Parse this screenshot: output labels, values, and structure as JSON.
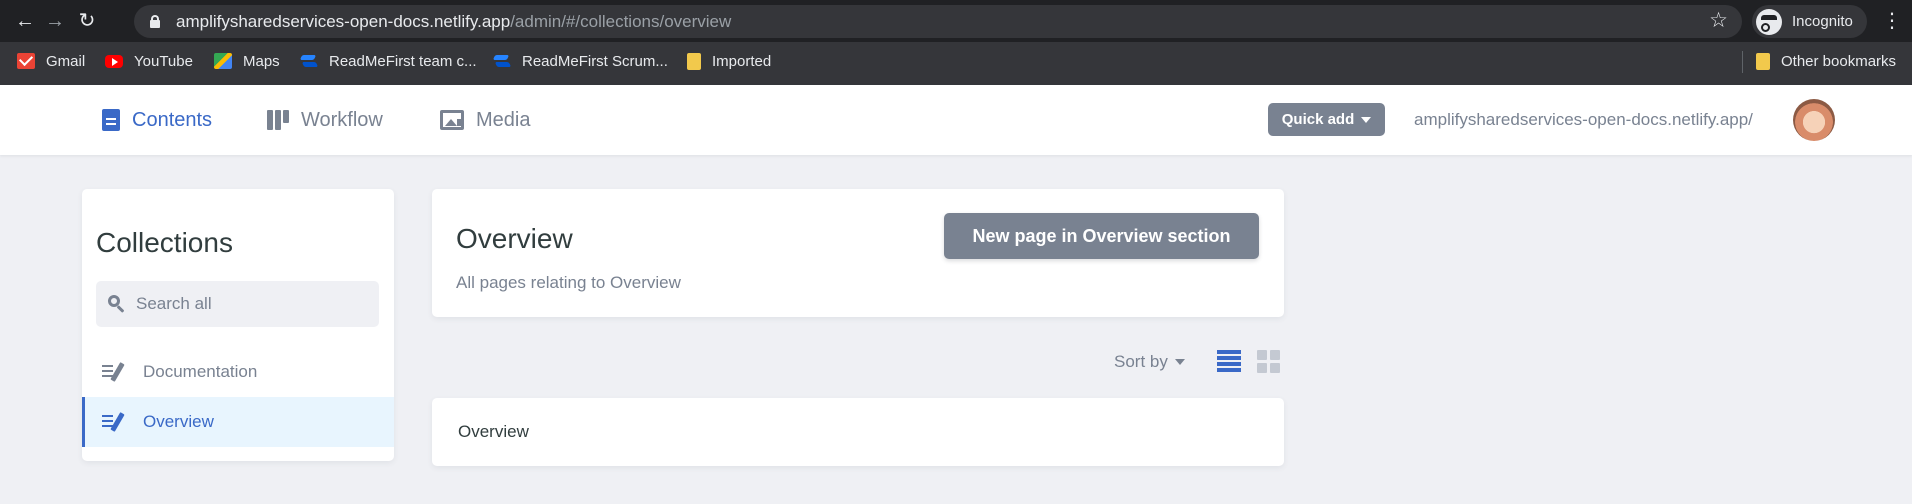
{
  "browser": {
    "url_host": "amplifysharedservices-open-docs.netlify.app",
    "url_path": "/admin/#/collections/overview",
    "profile_label": "Incognito",
    "bookmarks": [
      {
        "label": "Gmail",
        "icon": "gmail-icon"
      },
      {
        "label": "YouTube",
        "icon": "youtube-icon"
      },
      {
        "label": "Maps",
        "icon": "maps-icon"
      },
      {
        "label": "ReadMeFirst team c...",
        "icon": "readmefirst-icon"
      },
      {
        "label": "ReadMeFirst Scrum...",
        "icon": "readmefirst-icon"
      },
      {
        "label": "Imported",
        "icon": "folder-icon"
      }
    ],
    "other_bookmarks": "Other bookmarks"
  },
  "header": {
    "nav": [
      {
        "label": "Contents",
        "icon": "document-icon",
        "active": true
      },
      {
        "label": "Workflow",
        "icon": "workflow-icon",
        "active": false
      },
      {
        "label": "Media",
        "icon": "image-icon",
        "active": false
      }
    ],
    "quick_add": "Quick add",
    "site_link": "amplifysharedservices-open-docs.netlify.app/"
  },
  "sidebar": {
    "title": "Collections",
    "search_placeholder": "Search all",
    "items": [
      {
        "label": "Documentation",
        "active": false
      },
      {
        "label": "Overview",
        "active": true
      }
    ]
  },
  "main": {
    "title": "Overview",
    "description": "All pages relating to Overview",
    "new_button": "New page in Overview section",
    "sort_label": "Sort by",
    "entries": [
      {
        "title": "Overview"
      }
    ]
  },
  "colors": {
    "accent": "#3a69c7",
    "muted": "#798291",
    "background": "#eff0f4",
    "chrome_dark": "#202124"
  }
}
